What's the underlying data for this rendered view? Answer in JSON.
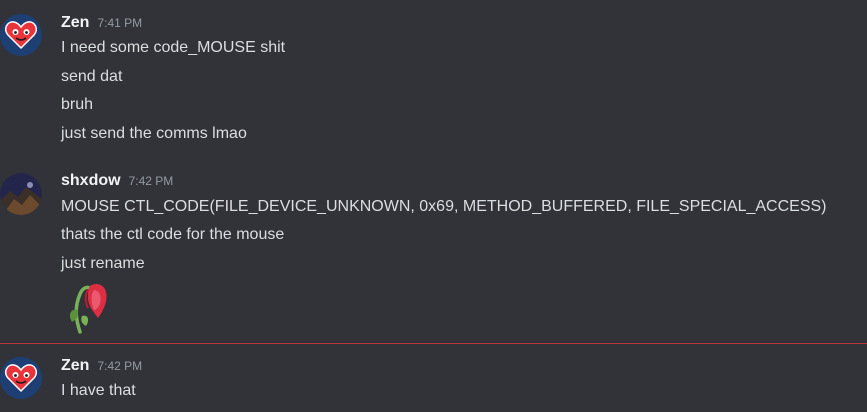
{
  "messages": [
    {
      "author": "Zen",
      "time": "7:41 PM",
      "lines": [
        "I need some code_MOUSE shit",
        "send dat",
        "bruh",
        "just send the comms lmao"
      ]
    },
    {
      "author": "shxdow",
      "time": "7:42 PM",
      "lines": [
        "MOUSE CTL_CODE(FILE_DEVICE_UNKNOWN, 0x69, METHOD_BUFFERED, FILE_SPECIAL_ACCESS)",
        "thats the ctl code for the mouse",
        "just rename"
      ],
      "emoji": "wilted-rose-icon"
    },
    {
      "author": "Zen",
      "time": "7:42 PM",
      "lines": [
        "I have that"
      ]
    }
  ],
  "colors": {
    "background": "#313338",
    "username": "#f2f3f5",
    "message_text": "#dbdee1",
    "timestamp": "#949ba4",
    "new_message_divider": "#b8363b"
  }
}
